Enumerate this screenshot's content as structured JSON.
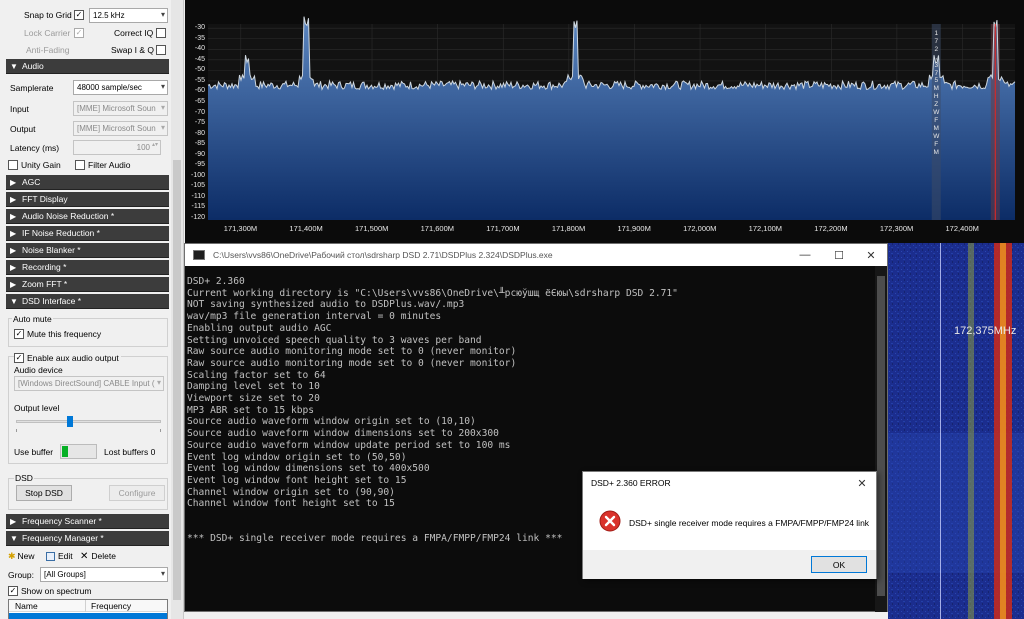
{
  "left_panel": {
    "snap_to_grid": {
      "label": "Snap to Grid",
      "checked": true,
      "value": "12.5 kHz"
    },
    "lock_carrier": {
      "label": "Lock Carrier",
      "checked": true,
      "disabled": true
    },
    "correct_iq": {
      "label": "Correct IQ",
      "checked": false
    },
    "anti_fading": {
      "label": "Anti-Fading",
      "disabled": true
    },
    "swap_iq": {
      "label": "Swap I & Q",
      "checked": false
    },
    "audio_header": "Audio",
    "samplerate": {
      "label": "Samplerate",
      "value": "48000 sample/sec"
    },
    "input": {
      "label": "Input",
      "value": "[MME] Microsoft Soun"
    },
    "output": {
      "label": "Output",
      "value": "[MME] Microsoft Soun"
    },
    "latency": {
      "label": "Latency (ms)",
      "value": "100"
    },
    "unity_gain": {
      "label": "Unity Gain",
      "checked": false
    },
    "filter_audio": {
      "label": "Filter Audio",
      "checked": false
    },
    "headers": {
      "agc": "AGC",
      "fft_display": "FFT Display",
      "audio_noise_reduction": "Audio Noise Reduction *",
      "if_noise_reduction": "IF Noise Reduction *",
      "noise_blanker": "Noise Blanker *",
      "recording": "Recording *",
      "zoom_fft": "Zoom FFT *",
      "dsd_interface": "DSD Interface *",
      "frequency_scanner": "Frequency Scanner *",
      "frequency_manager": "Frequency Manager *"
    },
    "dsd": {
      "auto_mute_label": "Auto mute",
      "mute_freq": {
        "label": "Mute this frequency",
        "checked": true
      },
      "aux_output": {
        "label": "Enable aux audio output",
        "checked": true
      },
      "audio_device_label": "Audio device",
      "audio_device_value": "[Windows DirectSound] CABLE Input (",
      "output_level_label": "Output level",
      "output_level_fraction": 0.37,
      "use_buffer_label": "Use buffer",
      "lost_buffers_label": "Lost buffers 0",
      "dsd_group_label": "DSD",
      "stop_dsd": "Stop DSD",
      "configure": "Configure"
    },
    "freq_manager": {
      "new": "New",
      "edit": "Edit",
      "delete": "Delete",
      "group_label": "Group:",
      "group_value": "[All Groups]",
      "show_on_spectrum": {
        "label": "Show on spectrum",
        "checked": true
      },
      "col_name": "Name",
      "col_frequency": "Frequency"
    }
  },
  "spectrum": {
    "y_ticks": [
      "-30",
      "-35",
      "-40",
      "-45",
      "-50",
      "-55",
      "-60",
      "-65",
      "-70",
      "-75",
      "-80",
      "-85",
      "-90",
      "-95",
      "-100",
      "-105",
      "-110",
      "-115",
      "-120"
    ],
    "x_ticks": [
      "171,300M",
      "171,400M",
      "171,500M",
      "171,600M",
      "171,700M",
      "171,800M",
      "171,900M",
      "172,000M",
      "172,100M",
      "172,200M",
      "172,300M",
      "172,400M"
    ],
    "x_start_mhz": 171.25,
    "x_end_mhz": 172.48,
    "peaks_mhz": [
      171.31,
      171.4,
      171.81,
      172.36,
      172.45
    ],
    "vfo_label_chars": [
      "1",
      "7",
      "2",
      ",",
      "3",
      "7",
      "5",
      "M",
      "H",
      "Z",
      "W",
      "F",
      "M",
      "",
      "W",
      "F",
      "M"
    ],
    "colors": {
      "trace": "#cfd8e0",
      "fill_top": "#5b86c0",
      "fill_bottom": "#0c2c66",
      "vfo": "#d02a2a"
    }
  },
  "waterfall": {
    "freq_label": "172,375MHz"
  },
  "console": {
    "title": "C:\\Users\\vvs86\\OneDrive\\Рабочий стол\\sdrsharp DSD 2.71\\DSDPlus 2.324\\DSDPlus.exe",
    "lines": [
      "DSD+ 2.360",
      "Current working directory is \"C:\\Users\\vvs86\\OneDrive\\╨рсюўшщ ёЄюы\\sdrsharp DSD 2.71\"",
      "NOT saving synthesized audio to DSDPlus.wav/.mp3",
      "wav/mp3 file generation interval = 0 minutes",
      "Enabling output audio AGC",
      "Setting unvoiced speech quality to 3 waves per band",
      "Raw source audio monitoring mode set to 0 (never monitor)",
      "Raw source audio monitoring mode set to 0 (never monitor)",
      "Scaling factor set to 64",
      "Damping level set to 10",
      "Viewport size set to 20",
      "MP3 ABR set to 15 kbps",
      "Source audio waveform window origin set to (10,10)",
      "Source audio waveform window dimensions set to 200x300",
      "Source audio waveform window update period set to 100 ms",
      "Event log window origin set to (50,50)",
      "Event log window dimensions set to 400x500",
      "Event log window font height set to 15",
      "Channel window origin set to (90,90)",
      "Channel window font height set to 15",
      "",
      "",
      "*** DSD+ single receiver mode requires a FMPA/FMPP/FMP24 link ***"
    ]
  },
  "dialog": {
    "title": "DSD+ 2.360  ERROR",
    "message": "DSD+ single receiver mode requires a FMPA/FMPP/FMP24 link",
    "ok": "OK"
  }
}
